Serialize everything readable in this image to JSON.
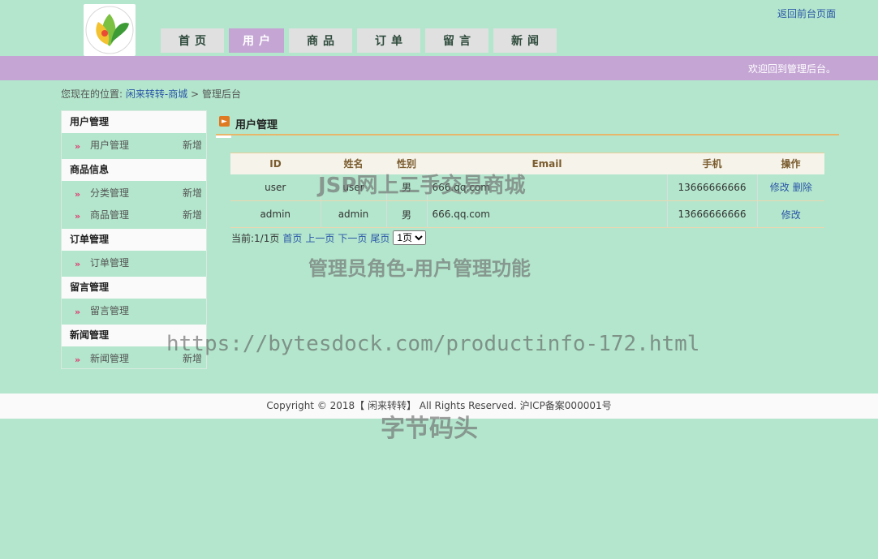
{
  "header": {
    "back_link": "返回前台页面",
    "nav": [
      "首页",
      "用户",
      "商品",
      "订单",
      "留言",
      "新闻"
    ],
    "active_nav": "用户",
    "welcome": "欢迎回到管理后台。"
  },
  "breadcrumb": {
    "prefix": "您现在的位置:",
    "site": "闲来转转-商城",
    "sep": ">",
    "current": "管理后台"
  },
  "sidebar": {
    "groups": [
      {
        "title": "用户管理",
        "items": [
          {
            "label": "用户管理",
            "add": "新增"
          }
        ]
      },
      {
        "title": "商品信息",
        "items": [
          {
            "label": "分类管理",
            "add": "新增"
          },
          {
            "label": "商品管理",
            "add": "新增"
          }
        ]
      },
      {
        "title": "订单管理",
        "items": [
          {
            "label": "订单管理",
            "add": ""
          }
        ]
      },
      {
        "title": "留言管理",
        "items": [
          {
            "label": "留言管理",
            "add": ""
          }
        ]
      },
      {
        "title": "新闻管理",
        "items": [
          {
            "label": "新闻管理",
            "add": "新增"
          }
        ]
      }
    ]
  },
  "panel": {
    "title": "用户管理",
    "columns": [
      "ID",
      "姓名",
      "性别",
      "Email",
      "手机",
      "操作"
    ],
    "rows": [
      {
        "id": "user",
        "name": "user",
        "gender": "男",
        "email": "666.qq.com",
        "phone": "13666666666",
        "ops": [
          "修改",
          "删除"
        ]
      },
      {
        "id": "admin",
        "name": "admin",
        "gender": "男",
        "email": "666.qq.com",
        "phone": "13666666666",
        "ops": [
          "修改"
        ]
      }
    ],
    "pager": {
      "status": "当前:1/1页",
      "first": "首页",
      "prev": "上一页",
      "next": "下一页",
      "last": "尾页",
      "selected_page": "1页"
    }
  },
  "footer": {
    "copyright": "Copyright © 2018【 闲来转转】 All Rights Reserved. 沪ICP备案000001号"
  },
  "watermarks": {
    "line1": "JSP网上二手交易商城",
    "line2": "管理员角色-用户管理功能",
    "line3": "https://bytesdock.com/productinfo-172.html",
    "line4": "字节码头"
  }
}
